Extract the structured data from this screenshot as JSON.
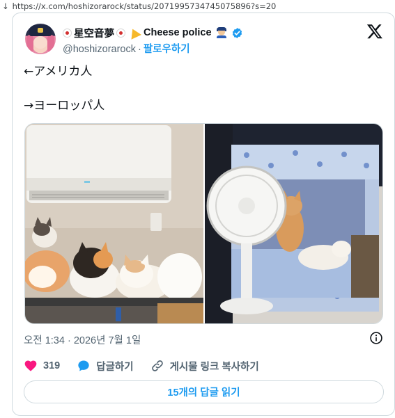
{
  "browser": {
    "download_arrow": "↓",
    "url": "https://x.com/hoshizorarock/status/2071995734745075896?s=20"
  },
  "author": {
    "name_text": "星空音夢",
    "name_suffix": "Cheese police",
    "handle": "@hoshizorarock",
    "separator": "·",
    "follow_label": "팔로우하기"
  },
  "tweet": {
    "line1": "←アメリカ人",
    "line2": "→ヨーロッパ人"
  },
  "media": {
    "photos": [
      {
        "subject": "cats-on-shelf-under-air-conditioner"
      },
      {
        "subject": "cats-in-tent-next-to-fan"
      }
    ]
  },
  "meta": {
    "timestamp": "오전 1:34 · 2026년 7월 1일"
  },
  "actions": {
    "like_count": "319",
    "reply_label": "답글하기",
    "copy_link_label": "게시물 링크 복사하기"
  },
  "replies": {
    "read_label": "15개의 답글 읽기"
  },
  "colors": {
    "accent": "#1d9bf0",
    "like": "#f91880",
    "muted": "#536471",
    "border": "#cfd9de"
  },
  "icons": {
    "logo": "x-logo-icon",
    "verified": "verified-badge-icon",
    "info": "info-icon",
    "like": "heart-icon",
    "reply": "speech-bubble-icon",
    "link": "link-icon"
  }
}
